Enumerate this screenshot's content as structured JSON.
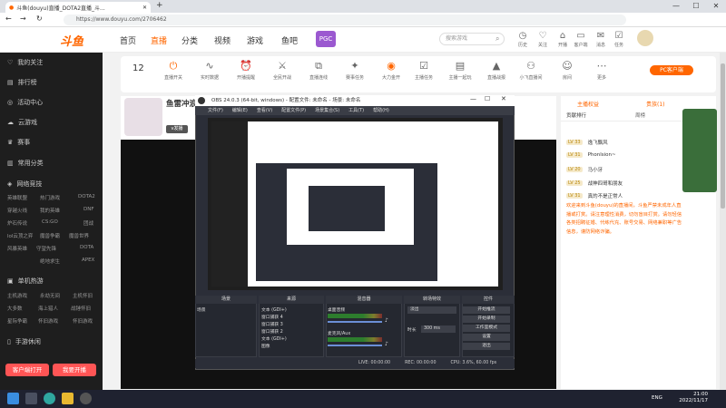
{
  "browser": {
    "tab_title": "斗鱼(douyu)直播_DOTA2直播_斗...",
    "url": "https://www.douyu.com/2706462"
  },
  "header": {
    "logo": "斗鱼",
    "nav": [
      "首页",
      "直播",
      "分类",
      "视频",
      "游戏",
      "鱼吧"
    ],
    "search_placeholder": "搜索游戏",
    "icons": [
      "历史",
      "关注",
      "开播",
      "客户端",
      "消息",
      "任务"
    ]
  },
  "sidebar": {
    "items": [
      "我的关注",
      "排行榜",
      "活动中心",
      "云游戏",
      "赛事"
    ],
    "section_common": "常用分类",
    "section_network": "网络竞技",
    "network_games": [
      [
        "英雄联盟",
        "热门游戏",
        "DOTA2"
      ],
      [
        "穿越火线",
        "我的英雄",
        "DNF"
      ],
      [
        "炉石传说",
        "CS:GO",
        "团战"
      ],
      [
        "lol云顶之弈",
        "魔兽争霸",
        "魔兽世界"
      ],
      [
        "风暴英雄",
        "守望先锋",
        "DOTA"
      ],
      [
        "绝地求生",
        "APEX"
      ]
    ],
    "section_pc": "单机热游",
    "pc_games": [
      [
        "主机游戏",
        "永劫无间",
        "主机怀旧"
      ],
      [
        "大多数",
        "海上猎人",
        "战锤怀旧"
      ],
      [
        "星际争霸",
        "怀旧游戏",
        "怀旧游戏"
      ]
    ],
    "section_mobile": "手游休闲",
    "btn_download": "客户端打开",
    "btn_live": "我要开播"
  },
  "toolbar": {
    "count": "12",
    "items": [
      "直播开关",
      "实时数据",
      "开播提醒",
      "全民开战",
      "直播连线",
      "赛事任务",
      "大力金开",
      "主播任务",
      "主播一起玩",
      "直播战报",
      "小飞直播间",
      "房间",
      "更多"
    ],
    "pc_button": "PC客户端"
  },
  "room": {
    "title": "鱼雷冲浪",
    "btn": "v发播"
  },
  "obs": {
    "title": "OBS 24.0.3 (64-bit, windows) - 配置文件: 未命名 - 场景: 未命名",
    "menu": [
      "文件(F)",
      "编辑(E)",
      "查看(V)",
      "配置文件(P)",
      "场景集合(S)",
      "工具(T)",
      "帮助(H)"
    ],
    "docks": [
      "场景",
      "来源",
      "混音器",
      "转场特效",
      "控件"
    ],
    "scene_item": "场景",
    "sources": [
      "文本 (GDI+)",
      "窗口捕获 4",
      "窗口捕获 3",
      "窗口捕获 2",
      "文本 (GDI+)",
      "图像"
    ],
    "mixer": [
      "桌面音频",
      "麦克风/Aux"
    ],
    "transition": "淡出",
    "duration_label": "时长",
    "duration": "300 ms",
    "controls": [
      "开始推流",
      "开始录制",
      "工作室模式",
      "设置",
      "退出"
    ],
    "status": [
      "LIVE: 00:00:00",
      "REC: 00:00:00",
      "CPU: 3.6%, 60.00 fps"
    ]
  },
  "right_panel": {
    "tabs": [
      "主播权益",
      "贡献排行",
      "周榜",
      "贵族(1)"
    ],
    "ranks": [
      {
        "lv": "LV 33",
        "name": "逸飞飘风"
      },
      {
        "lv": "LV 31",
        "name": "Phonlsion~"
      },
      {
        "lv": "LV 20",
        "name": "马小牙"
      },
      {
        "lv": "LV 25",
        "name": "战神四哥和朋友"
      },
      {
        "lv": "LV 31",
        "name": "真的不是正常人"
      }
    ],
    "notice": "欢迎来到斗鱼(douyu)的直播间，斗鱼严禁未成年人直播或打赏。请注意理性消费，切勿盲目打赏。请勿轻信各类招聘征婚、代练代充、账号交易、网络兼职等广告信息，谨防网络诈骗。"
  },
  "taskbar": {
    "time": "21:00",
    "date": "2022/11/17",
    "lang": "ENG"
  }
}
